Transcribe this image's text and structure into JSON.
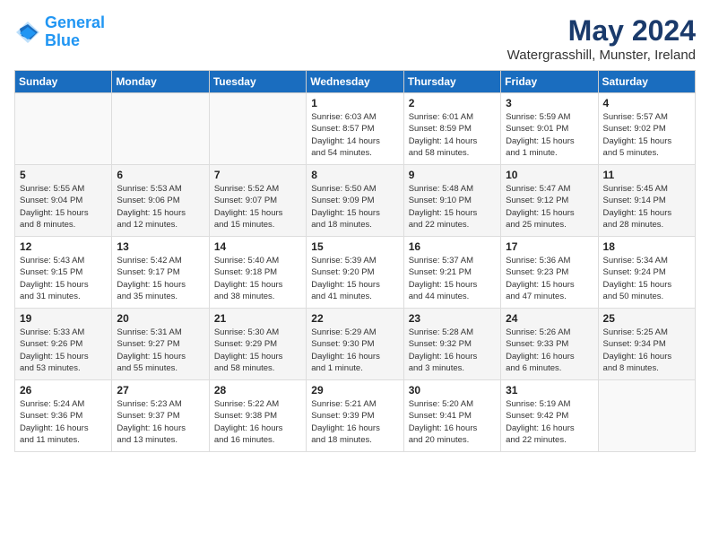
{
  "header": {
    "logo_line1": "General",
    "logo_line2": "Blue",
    "month": "May 2024",
    "location": "Watergrasshill, Munster, Ireland"
  },
  "weekdays": [
    "Sunday",
    "Monday",
    "Tuesday",
    "Wednesday",
    "Thursday",
    "Friday",
    "Saturday"
  ],
  "weeks": [
    [
      {
        "day": "",
        "content": ""
      },
      {
        "day": "",
        "content": ""
      },
      {
        "day": "",
        "content": ""
      },
      {
        "day": "1",
        "content": "Sunrise: 6:03 AM\nSunset: 8:57 PM\nDaylight: 14 hours\nand 54 minutes."
      },
      {
        "day": "2",
        "content": "Sunrise: 6:01 AM\nSunset: 8:59 PM\nDaylight: 14 hours\nand 58 minutes."
      },
      {
        "day": "3",
        "content": "Sunrise: 5:59 AM\nSunset: 9:01 PM\nDaylight: 15 hours\nand 1 minute."
      },
      {
        "day": "4",
        "content": "Sunrise: 5:57 AM\nSunset: 9:02 PM\nDaylight: 15 hours\nand 5 minutes."
      }
    ],
    [
      {
        "day": "5",
        "content": "Sunrise: 5:55 AM\nSunset: 9:04 PM\nDaylight: 15 hours\nand 8 minutes."
      },
      {
        "day": "6",
        "content": "Sunrise: 5:53 AM\nSunset: 9:06 PM\nDaylight: 15 hours\nand 12 minutes."
      },
      {
        "day": "7",
        "content": "Sunrise: 5:52 AM\nSunset: 9:07 PM\nDaylight: 15 hours\nand 15 minutes."
      },
      {
        "day": "8",
        "content": "Sunrise: 5:50 AM\nSunset: 9:09 PM\nDaylight: 15 hours\nand 18 minutes."
      },
      {
        "day": "9",
        "content": "Sunrise: 5:48 AM\nSunset: 9:10 PM\nDaylight: 15 hours\nand 22 minutes."
      },
      {
        "day": "10",
        "content": "Sunrise: 5:47 AM\nSunset: 9:12 PM\nDaylight: 15 hours\nand 25 minutes."
      },
      {
        "day": "11",
        "content": "Sunrise: 5:45 AM\nSunset: 9:14 PM\nDaylight: 15 hours\nand 28 minutes."
      }
    ],
    [
      {
        "day": "12",
        "content": "Sunrise: 5:43 AM\nSunset: 9:15 PM\nDaylight: 15 hours\nand 31 minutes."
      },
      {
        "day": "13",
        "content": "Sunrise: 5:42 AM\nSunset: 9:17 PM\nDaylight: 15 hours\nand 35 minutes."
      },
      {
        "day": "14",
        "content": "Sunrise: 5:40 AM\nSunset: 9:18 PM\nDaylight: 15 hours\nand 38 minutes."
      },
      {
        "day": "15",
        "content": "Sunrise: 5:39 AM\nSunset: 9:20 PM\nDaylight: 15 hours\nand 41 minutes."
      },
      {
        "day": "16",
        "content": "Sunrise: 5:37 AM\nSunset: 9:21 PM\nDaylight: 15 hours\nand 44 minutes."
      },
      {
        "day": "17",
        "content": "Sunrise: 5:36 AM\nSunset: 9:23 PM\nDaylight: 15 hours\nand 47 minutes."
      },
      {
        "day": "18",
        "content": "Sunrise: 5:34 AM\nSunset: 9:24 PM\nDaylight: 15 hours\nand 50 minutes."
      }
    ],
    [
      {
        "day": "19",
        "content": "Sunrise: 5:33 AM\nSunset: 9:26 PM\nDaylight: 15 hours\nand 53 minutes."
      },
      {
        "day": "20",
        "content": "Sunrise: 5:31 AM\nSunset: 9:27 PM\nDaylight: 15 hours\nand 55 minutes."
      },
      {
        "day": "21",
        "content": "Sunrise: 5:30 AM\nSunset: 9:29 PM\nDaylight: 15 hours\nand 58 minutes."
      },
      {
        "day": "22",
        "content": "Sunrise: 5:29 AM\nSunset: 9:30 PM\nDaylight: 16 hours\nand 1 minute."
      },
      {
        "day": "23",
        "content": "Sunrise: 5:28 AM\nSunset: 9:32 PM\nDaylight: 16 hours\nand 3 minutes."
      },
      {
        "day": "24",
        "content": "Sunrise: 5:26 AM\nSunset: 9:33 PM\nDaylight: 16 hours\nand 6 minutes."
      },
      {
        "day": "25",
        "content": "Sunrise: 5:25 AM\nSunset: 9:34 PM\nDaylight: 16 hours\nand 8 minutes."
      }
    ],
    [
      {
        "day": "26",
        "content": "Sunrise: 5:24 AM\nSunset: 9:36 PM\nDaylight: 16 hours\nand 11 minutes."
      },
      {
        "day": "27",
        "content": "Sunrise: 5:23 AM\nSunset: 9:37 PM\nDaylight: 16 hours\nand 13 minutes."
      },
      {
        "day": "28",
        "content": "Sunrise: 5:22 AM\nSunset: 9:38 PM\nDaylight: 16 hours\nand 16 minutes."
      },
      {
        "day": "29",
        "content": "Sunrise: 5:21 AM\nSunset: 9:39 PM\nDaylight: 16 hours\nand 18 minutes."
      },
      {
        "day": "30",
        "content": "Sunrise: 5:20 AM\nSunset: 9:41 PM\nDaylight: 16 hours\nand 20 minutes."
      },
      {
        "day": "31",
        "content": "Sunrise: 5:19 AM\nSunset: 9:42 PM\nDaylight: 16 hours\nand 22 minutes."
      },
      {
        "day": "",
        "content": ""
      }
    ]
  ]
}
